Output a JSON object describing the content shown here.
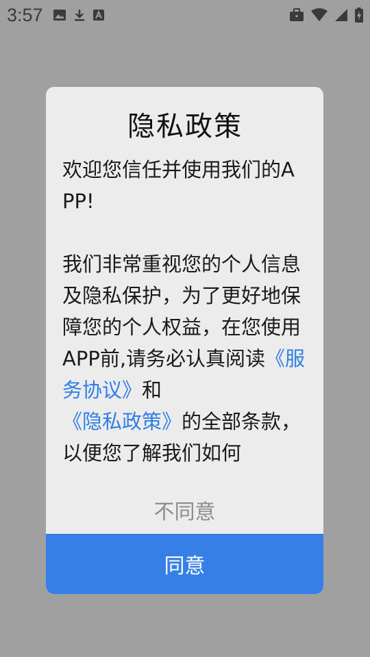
{
  "status_bar": {
    "time": "3:57",
    "icons_left": [
      "image-icon",
      "download-icon",
      "text-a-icon"
    ],
    "icons_right": [
      "briefcase-icon",
      "wifi-icon",
      "signal-icon",
      "battery-icon"
    ]
  },
  "dialog": {
    "title": "隐私政策",
    "welcome_line": "欢迎您信任并使用我们的APP!",
    "body_pre": " 我们非常重视您的个人信息及隐私保护，为了更好地保障您的个人权益，在您使用APP前,请务必认真阅读",
    "link_service": "《服务协议》",
    "body_and": "和",
    "link_privacy": "《隐私政策》",
    "body_post": "的全部条款，以便您了解我们如何",
    "disagree_label": "不同意",
    "agree_label": "同意"
  },
  "colors": {
    "overlay": "#a0a0a0",
    "dialog_bg": "#ececec",
    "link": "#2f7fe8",
    "agree_bg": "#367fe6"
  }
}
